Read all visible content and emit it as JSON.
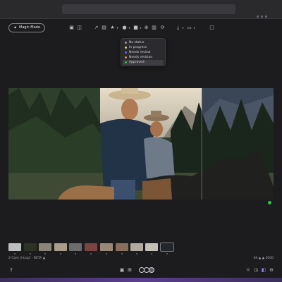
{
  "toolbar": {
    "magic_mode_label": "Magic Mode"
  },
  "status_menu": {
    "items": [
      {
        "label": "No status",
        "color": "#9a9aa0"
      },
      {
        "label": "In progress",
        "color": "#e8d24a"
      },
      {
        "label": "Needs review",
        "color": "#6a5cff"
      },
      {
        "label": "Needs revision",
        "color": "#f08a24"
      },
      {
        "label": "Approved",
        "color": "#27c93f"
      }
    ],
    "selected_index": 4
  },
  "viewer": {
    "compare_slider": true
  },
  "footer": {
    "info": "2-Cam 3-Log1 · BETA ▲",
    "resolution": "4K ▲ ▲ 4000"
  },
  "icons": {
    "top": [
      "share-icon",
      "gallery-icon",
      "star-icon",
      "status-icon",
      "video-icon",
      "plus-icon",
      "refresh-icon",
      "trash-icon",
      "timer-icon",
      "download-icon",
      "view-icon",
      "comment-icon"
    ],
    "bottom": [
      "upload-icon",
      "aspect-icon",
      "crop-icon",
      "playback-controls",
      "brightness-icon",
      "time-icon",
      "compare-icon",
      "more-icon"
    ]
  },
  "colors": {
    "background": "#1c1c1e",
    "accent": "#5b3f8f",
    "approved": "#27c93f"
  }
}
